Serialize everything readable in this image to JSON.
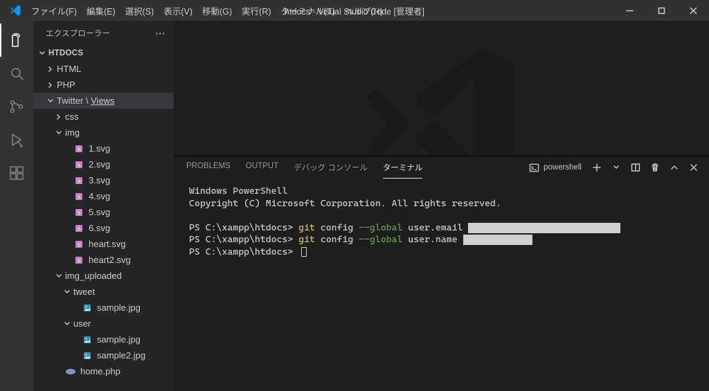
{
  "titlebar": {
    "title": "htdocs - Visual Studio Code [管理者]",
    "menu": [
      "ファイル(F)",
      "編集(E)",
      "選択(S)",
      "表示(V)",
      "移動(G)",
      "実行(R)",
      "ターミナル(T)",
      "ヘルプ(H)"
    ]
  },
  "activity": {
    "items": [
      "files",
      "search",
      "source-control",
      "run-debug",
      "extensions"
    ],
    "active": 0
  },
  "sidebar": {
    "title": "エクスプローラー",
    "root": "HTDOCS",
    "tree": [
      {
        "d": 1,
        "tw": "right",
        "kind": "folder",
        "label": "HTML"
      },
      {
        "d": 1,
        "tw": "right",
        "kind": "folder",
        "label": "PHP"
      },
      {
        "d": 1,
        "tw": "down",
        "kind": "folder",
        "label": "Twitter",
        "suffix": "Views",
        "selected": true
      },
      {
        "d": 2,
        "tw": "right",
        "kind": "folder",
        "label": "css"
      },
      {
        "d": 2,
        "tw": "down",
        "kind": "folder",
        "label": "img"
      },
      {
        "d": 3,
        "kind": "svg",
        "label": "1.svg"
      },
      {
        "d": 3,
        "kind": "svg",
        "label": "2.svg"
      },
      {
        "d": 3,
        "kind": "svg",
        "label": "3.svg"
      },
      {
        "d": 3,
        "kind": "svg",
        "label": "4.svg"
      },
      {
        "d": 3,
        "kind": "svg",
        "label": "5.svg"
      },
      {
        "d": 3,
        "kind": "svg",
        "label": "6.svg"
      },
      {
        "d": 3,
        "kind": "svg",
        "label": "heart.svg"
      },
      {
        "d": 3,
        "kind": "svg",
        "label": "heart2.svg"
      },
      {
        "d": 2,
        "tw": "down",
        "kind": "folder",
        "label": "img_uploaded"
      },
      {
        "d": 3,
        "tw": "down",
        "kind": "folder",
        "label": "tweet"
      },
      {
        "d": 4,
        "kind": "img",
        "label": "sample.jpg"
      },
      {
        "d": 3,
        "tw": "down",
        "kind": "folder",
        "label": "user"
      },
      {
        "d": 4,
        "kind": "img",
        "label": "sample.jpg"
      },
      {
        "d": 4,
        "kind": "img",
        "label": "sample2.jpg"
      },
      {
        "d": 2,
        "kind": "php",
        "label": "home.php"
      }
    ]
  },
  "panel": {
    "tabs": [
      "PROBLEMS",
      "OUTPUT",
      "デバッグ コンソール",
      "ターミナル"
    ],
    "active": 3,
    "shell": "powershell"
  },
  "terminal": {
    "banner1": "Windows PowerShell",
    "banner2": "Copyright (C) Microsoft Corporation. All rights reserved.",
    "lines": [
      {
        "prompt": "PS C:\\xampp\\htdocs>",
        "cmd": "git",
        "arg": "config",
        "flag": "--global",
        "rest": "user.email ",
        "redact": 220
      },
      {
        "prompt": "PS C:\\xampp\\htdocs>",
        "cmd": "git",
        "arg": "config",
        "flag": "--global",
        "rest": "user.name ",
        "redact": 100
      },
      {
        "prompt": "PS C:\\xampp\\htdocs>",
        "cursor": true
      }
    ]
  }
}
